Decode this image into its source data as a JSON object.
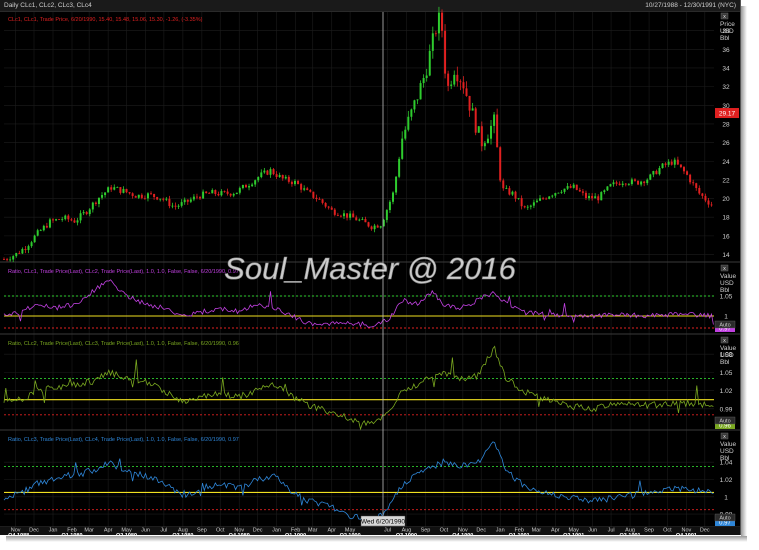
{
  "window": {
    "title": "Daily CLc1, CLc2, CLc3, CLc4",
    "date_range": "10/27/1988 - 12/30/1991 (NYC)"
  },
  "watermark": "Soul_Master @ 2016",
  "crosshair_label": "Wed 6/20/1990",
  "axis_buttons": {
    "close": "x",
    "auto": "Auto"
  },
  "colors": {
    "candle_up": "#2ecc2e",
    "candle_down": "#e02020",
    "ratio1": "#c040e0",
    "ratio2": "#7aa820",
    "ratio3": "#2e86d8",
    "band_upper": "#2ecc2e",
    "band_lower": "#e02020",
    "mean_line": "#f0e020",
    "price_marker": "#e02020"
  },
  "chart_data": [
    {
      "type": "candlestick",
      "legend": "CLc1, CLc1, Trade Price, 6/20/1990, 15.40, 15.48, 15.06, 15.30, -1.26, (-3.35%)",
      "axis_header": [
        "Price",
        "USD",
        "Bbl"
      ],
      "y_ticks": [
        14,
        16,
        18,
        20,
        22,
        24,
        26,
        28,
        30,
        32,
        34,
        36,
        38
      ],
      "ylim": [
        13.2,
        40
      ],
      "last_value_label": "29.17",
      "close_series": [
        {
          "date": "1988-10-27",
          "close": 13.5
        },
        {
          "date": "1988-11-15",
          "close": 14.0
        },
        {
          "date": "1988-12-01",
          "close": 14.8
        },
        {
          "date": "1988-12-20",
          "close": 16.2
        },
        {
          "date": "1989-01-10",
          "close": 17.5
        },
        {
          "date": "1989-02-01",
          "close": 17.9
        },
        {
          "date": "1989-02-20",
          "close": 17.6
        },
        {
          "date": "1989-03-10",
          "close": 18.6
        },
        {
          "date": "1989-04-01",
          "close": 20.2
        },
        {
          "date": "1989-04-20",
          "close": 21.2
        },
        {
          "date": "1989-05-10",
          "close": 20.8
        },
        {
          "date": "1989-06-01",
          "close": 20.3
        },
        {
          "date": "1989-06-20",
          "close": 20.4
        },
        {
          "date": "1989-07-10",
          "close": 20.1
        },
        {
          "date": "1989-08-01",
          "close": 19.1
        },
        {
          "date": "1989-08-20",
          "close": 19.6
        },
        {
          "date": "1989-09-10",
          "close": 20.3
        },
        {
          "date": "1989-10-01",
          "close": 20.6
        },
        {
          "date": "1989-10-20",
          "close": 20.5
        },
        {
          "date": "1989-11-10",
          "close": 20.7
        },
        {
          "date": "1989-12-01",
          "close": 21.6
        },
        {
          "date": "1989-12-20",
          "close": 22.5
        },
        {
          "date": "1990-01-05",
          "close": 23.0
        },
        {
          "date": "1990-01-25",
          "close": 22.1
        },
        {
          "date": "1990-02-15",
          "close": 21.7
        },
        {
          "date": "1990-03-05",
          "close": 20.7
        },
        {
          "date": "1990-03-25",
          "close": 19.9
        },
        {
          "date": "1990-04-15",
          "close": 18.7
        },
        {
          "date": "1990-05-05",
          "close": 18.3
        },
        {
          "date": "1990-05-25",
          "close": 17.8
        },
        {
          "date": "1990-06-20",
          "close": 17.0
        },
        {
          "date": "1990-07-05",
          "close": 17.3
        },
        {
          "date": "1990-07-25",
          "close": 20.7
        },
        {
          "date": "1990-08-08",
          "close": 26.5
        },
        {
          "date": "1990-08-25",
          "close": 29.5
        },
        {
          "date": "1990-09-15",
          "close": 33.5
        },
        {
          "date": "1990-10-01",
          "close": 38.0
        },
        {
          "date": "1990-10-10",
          "close": 39.8
        },
        {
          "date": "1990-10-20",
          "close": 31.5
        },
        {
          "date": "1990-11-01",
          "close": 34.0
        },
        {
          "date": "1990-11-15",
          "close": 32.5
        },
        {
          "date": "1990-12-01",
          "close": 29.0
        },
        {
          "date": "1990-12-15",
          "close": 26.0
        },
        {
          "date": "1991-01-05",
          "close": 28.2
        },
        {
          "date": "1991-01-17",
          "close": 21.0
        },
        {
          "date": "1991-02-05",
          "close": 20.5
        },
        {
          "date": "1991-02-25",
          "close": 18.8
        },
        {
          "date": "1991-03-15",
          "close": 19.6
        },
        {
          "date": "1991-04-05",
          "close": 20.4
        },
        {
          "date": "1991-04-25",
          "close": 21.0
        },
        {
          "date": "1991-05-15",
          "close": 21.2
        },
        {
          "date": "1991-06-05",
          "close": 20.1
        },
        {
          "date": "1991-06-25",
          "close": 20.1
        },
        {
          "date": "1991-07-15",
          "close": 21.4
        },
        {
          "date": "1991-08-05",
          "close": 21.9
        },
        {
          "date": "1991-08-25",
          "close": 21.7
        },
        {
          "date": "1991-09-15",
          "close": 22.2
        },
        {
          "date": "1991-10-05",
          "close": 23.4
        },
        {
          "date": "1991-10-25",
          "close": 24.0
        },
        {
          "date": "1991-11-15",
          "close": 22.6
        },
        {
          "date": "1991-12-05",
          "close": 20.6
        },
        {
          "date": "1991-12-30",
          "close": 19.1
        }
      ]
    },
    {
      "type": "line",
      "legend": "Ratio, CLc1, Trade Price(Last), CLc2, Trade Price(Last), 1.0, 1.0, False, False, 6/20/1990, 0.97",
      "axis_header": [
        "Value",
        "USD",
        "Bbl"
      ],
      "y_ticks": [
        1,
        1.05
      ],
      "ylim": [
        0.955,
        1.13
      ],
      "last_value_label": "0.97",
      "bands": {
        "upper": 1.05,
        "lower": 0.97,
        "mean": 1.0
      },
      "series": [
        {
          "date": "1988-10-27",
          "value": 1.0
        },
        {
          "date": "1988-11-25",
          "value": 1.01
        },
        {
          "date": "1988-12-20",
          "value": 1.03
        },
        {
          "date": "1989-01-20",
          "value": 1.02
        },
        {
          "date": "1989-02-20",
          "value": 1.03
        },
        {
          "date": "1989-03-20",
          "value": 1.06
        },
        {
          "date": "1989-04-15",
          "value": 1.09
        },
        {
          "date": "1989-05-15",
          "value": 1.05
        },
        {
          "date": "1989-06-15",
          "value": 1.03
        },
        {
          "date": "1989-07-15",
          "value": 1.02
        },
        {
          "date": "1989-08-15",
          "value": 1.0
        },
        {
          "date": "1989-09-15",
          "value": 1.01
        },
        {
          "date": "1989-10-15",
          "value": 1.02
        },
        {
          "date": "1989-11-15",
          "value": 1.01
        },
        {
          "date": "1989-12-15",
          "value": 1.03
        },
        {
          "date": "1990-01-10",
          "value": 1.02
        },
        {
          "date": "1990-02-10",
          "value": 1.0
        },
        {
          "date": "1990-03-10",
          "value": 0.98
        },
        {
          "date": "1990-04-10",
          "value": 0.98
        },
        {
          "date": "1990-05-10",
          "value": 0.985
        },
        {
          "date": "1990-06-20",
          "value": 0.975
        },
        {
          "date": "1990-07-15",
          "value": 0.99
        },
        {
          "date": "1990-08-10",
          "value": 1.04
        },
        {
          "date": "1990-09-01",
          "value": 1.03
        },
        {
          "date": "1990-09-25",
          "value": 1.06
        },
        {
          "date": "1990-10-15",
          "value": 1.03
        },
        {
          "date": "1990-11-10",
          "value": 1.02
        },
        {
          "date": "1990-12-10",
          "value": 1.04
        },
        {
          "date": "1991-01-05",
          "value": 1.06
        },
        {
          "date": "1991-01-25",
          "value": 1.03
        },
        {
          "date": "1991-02-20",
          "value": 1.01
        },
        {
          "date": "1991-03-20",
          "value": 1.005
        },
        {
          "date": "1991-05-01",
          "value": 1.0
        },
        {
          "date": "1991-06-15",
          "value": 1.0
        },
        {
          "date": "1991-08-01",
          "value": 1.005
        },
        {
          "date": "1991-09-15",
          "value": 1.0
        },
        {
          "date": "1991-11-01",
          "value": 1.005
        },
        {
          "date": "1991-12-30",
          "value": 1.0
        }
      ]
    },
    {
      "type": "line",
      "legend": "Ratio, CLc2, Trade Price(Last), CLc3, Trade Price(Last), 1.0, 1.0, False, False, 6/20/1990, 0.96",
      "axis_header": [
        "Value",
        "USD",
        "Bbl"
      ],
      "y_ticks": [
        0.99,
        1.02,
        1.05,
        1.08
      ],
      "ylim": [
        0.955,
        1.11
      ],
      "last_value_label": "0.96",
      "bands": {
        "upper": 1.04,
        "lower": 0.98,
        "mean": 1.005
      },
      "series": [
        {
          "date": "1988-10-27",
          "value": 1.0
        },
        {
          "date": "1988-11-25",
          "value": 1.005
        },
        {
          "date": "1988-12-20",
          "value": 1.02
        },
        {
          "date": "1989-01-20",
          "value": 1.025
        },
        {
          "date": "1989-02-20",
          "value": 1.03
        },
        {
          "date": "1989-03-20",
          "value": 1.035
        },
        {
          "date": "1989-04-15",
          "value": 1.05
        },
        {
          "date": "1989-05-15",
          "value": 1.04
        },
        {
          "date": "1989-06-15",
          "value": 1.035
        },
        {
          "date": "1989-07-15",
          "value": 1.02
        },
        {
          "date": "1989-08-15",
          "value": 1.0
        },
        {
          "date": "1989-09-15",
          "value": 1.01
        },
        {
          "date": "1989-10-15",
          "value": 1.015
        },
        {
          "date": "1989-11-15",
          "value": 1.01
        },
        {
          "date": "1989-12-15",
          "value": 1.02
        },
        {
          "date": "1990-01-10",
          "value": 1.03
        },
        {
          "date": "1990-02-10",
          "value": 1.01
        },
        {
          "date": "1990-03-10",
          "value": 0.995
        },
        {
          "date": "1990-04-10",
          "value": 0.985
        },
        {
          "date": "1990-05-10",
          "value": 0.975
        },
        {
          "date": "1990-06-20",
          "value": 0.965
        },
        {
          "date": "1990-07-15",
          "value": 0.985
        },
        {
          "date": "1990-08-10",
          "value": 1.02
        },
        {
          "date": "1990-09-01",
          "value": 1.03
        },
        {
          "date": "1990-09-25",
          "value": 1.045
        },
        {
          "date": "1990-10-15",
          "value": 1.05
        },
        {
          "date": "1990-11-10",
          "value": 1.04
        },
        {
          "date": "1990-12-10",
          "value": 1.045
        },
        {
          "date": "1991-01-05",
          "value": 1.09
        },
        {
          "date": "1991-01-25",
          "value": 1.04
        },
        {
          "date": "1991-02-20",
          "value": 1.02
        },
        {
          "date": "1991-03-20",
          "value": 1.01
        },
        {
          "date": "1991-05-01",
          "value": 0.995
        },
        {
          "date": "1991-06-15",
          "value": 0.99
        },
        {
          "date": "1991-08-01",
          "value": 1.0
        },
        {
          "date": "1991-09-15",
          "value": 0.995
        },
        {
          "date": "1991-11-01",
          "value": 1.0
        },
        {
          "date": "1991-12-30",
          "value": 0.995
        }
      ]
    },
    {
      "type": "line",
      "legend": "Ratio, CLc3, Trade Price(Last), CLc4, Trade Price(Last), 1.0, 1.0, False, False, 6/20/1990, 0.97",
      "axis_header": [
        "Value",
        "USD",
        "Bbl"
      ],
      "y_ticks": [
        0.98,
        1,
        1.02,
        1.04
      ],
      "ylim": [
        0.965,
        1.075
      ],
      "last_value_label": "0.97",
      "bands": {
        "upper": 1.035,
        "lower": 0.985,
        "mean": 1.005
      },
      "series": [
        {
          "date": "1988-10-27",
          "value": 1.0
        },
        {
          "date": "1988-11-25",
          "value": 1.005
        },
        {
          "date": "1988-12-20",
          "value": 1.015
        },
        {
          "date": "1989-01-20",
          "value": 1.02
        },
        {
          "date": "1989-02-20",
          "value": 1.025
        },
        {
          "date": "1989-03-20",
          "value": 1.03
        },
        {
          "date": "1989-04-15",
          "value": 1.04
        },
        {
          "date": "1989-05-15",
          "value": 1.03
        },
        {
          "date": "1989-06-15",
          "value": 1.025
        },
        {
          "date": "1989-07-15",
          "value": 1.015
        },
        {
          "date": "1989-08-15",
          "value": 1.0
        },
        {
          "date": "1989-09-15",
          "value": 1.005
        },
        {
          "date": "1989-10-15",
          "value": 1.015
        },
        {
          "date": "1989-11-15",
          "value": 1.01
        },
        {
          "date": "1989-12-15",
          "value": 1.02
        },
        {
          "date": "1990-01-10",
          "value": 1.025
        },
        {
          "date": "1990-02-10",
          "value": 1.005
        },
        {
          "date": "1990-03-10",
          "value": 0.995
        },
        {
          "date": "1990-04-10",
          "value": 0.99
        },
        {
          "date": "1990-05-10",
          "value": 0.98
        },
        {
          "date": "1990-06-20",
          "value": 0.97
        },
        {
          "date": "1990-07-15",
          "value": 0.985
        },
        {
          "date": "1990-08-10",
          "value": 1.015
        },
        {
          "date": "1990-09-01",
          "value": 1.025
        },
        {
          "date": "1990-09-25",
          "value": 1.035
        },
        {
          "date": "1990-10-15",
          "value": 1.04
        },
        {
          "date": "1990-11-10",
          "value": 1.035
        },
        {
          "date": "1990-12-10",
          "value": 1.04
        },
        {
          "date": "1991-01-05",
          "value": 1.065
        },
        {
          "date": "1991-01-25",
          "value": 1.03
        },
        {
          "date": "1991-02-20",
          "value": 1.015
        },
        {
          "date": "1991-03-20",
          "value": 1.005
        },
        {
          "date": "1991-05-01",
          "value": 1.0
        },
        {
          "date": "1991-06-15",
          "value": 0.995
        },
        {
          "date": "1991-08-01",
          "value": 1.0
        },
        {
          "date": "1991-09-15",
          "value": 1.005
        },
        {
          "date": "1991-11-01",
          "value": 1.01
        },
        {
          "date": "1991-12-30",
          "value": 1.005
        }
      ]
    }
  ],
  "x_axis": {
    "months": [
      {
        "label": "Nov",
        "date": "1988-11-15"
      },
      {
        "label": "Dec",
        "date": "1988-12-15"
      },
      {
        "label": "Jan",
        "date": "1989-01-15"
      },
      {
        "label": "Feb",
        "date": "1989-02-15"
      },
      {
        "label": "Mar",
        "date": "1989-03-15"
      },
      {
        "label": "Apr",
        "date": "1989-04-15"
      },
      {
        "label": "May",
        "date": "1989-05-15"
      },
      {
        "label": "Jun",
        "date": "1989-06-15"
      },
      {
        "label": "Jul",
        "date": "1989-07-15"
      },
      {
        "label": "Aug",
        "date": "1989-08-15"
      },
      {
        "label": "Sep",
        "date": "1989-09-15"
      },
      {
        "label": "Oct",
        "date": "1989-10-15"
      },
      {
        "label": "Nov",
        "date": "1989-11-15"
      },
      {
        "label": "Dec",
        "date": "1989-12-15"
      },
      {
        "label": "Jan",
        "date": "1990-01-15"
      },
      {
        "label": "Feb",
        "date": "1990-02-15"
      },
      {
        "label": "Mar",
        "date": "1990-03-15"
      },
      {
        "label": "Apr",
        "date": "1990-04-15"
      },
      {
        "label": "May",
        "date": "1990-05-15"
      },
      {
        "label": "Jul",
        "date": "1990-07-15"
      },
      {
        "label": "Aug",
        "date": "1990-08-15"
      },
      {
        "label": "Sep",
        "date": "1990-09-15"
      },
      {
        "label": "Oct",
        "date": "1990-10-15"
      },
      {
        "label": "Nov",
        "date": "1990-11-15"
      },
      {
        "label": "Dec",
        "date": "1990-12-15"
      },
      {
        "label": "Jan",
        "date": "1991-01-15"
      },
      {
        "label": "Feb",
        "date": "1991-02-15"
      },
      {
        "label": "Mar",
        "date": "1991-03-15"
      },
      {
        "label": "Apr",
        "date": "1991-04-15"
      },
      {
        "label": "May",
        "date": "1991-05-15"
      },
      {
        "label": "Jun",
        "date": "1991-06-15"
      },
      {
        "label": "Jul",
        "date": "1991-07-15"
      },
      {
        "label": "Aug",
        "date": "1991-08-15"
      },
      {
        "label": "Sep",
        "date": "1991-09-15"
      },
      {
        "label": "Oct",
        "date": "1991-10-15"
      },
      {
        "label": "Nov",
        "date": "1991-11-15"
      },
      {
        "label": "Dec",
        "date": "1991-12-15"
      }
    ],
    "quarters": [
      {
        "label": "Q4 1988",
        "date": "1988-11-20"
      },
      {
        "label": "Q1 1989",
        "date": "1989-02-15"
      },
      {
        "label": "Q2 1989",
        "date": "1989-05-15"
      },
      {
        "label": "Q3 1989",
        "date": "1989-08-15"
      },
      {
        "label": "Q4 1989",
        "date": "1989-11-15"
      },
      {
        "label": "Q1 1990",
        "date": "1990-02-15"
      },
      {
        "label": "Q2 1990",
        "date": "1990-05-15"
      },
      {
        "label": "Q3 1990",
        "date": "1990-08-15"
      },
      {
        "label": "Q4 1990",
        "date": "1990-11-15"
      },
      {
        "label": "Q1 1991",
        "date": "1991-02-15"
      },
      {
        "label": "Q2 1991",
        "date": "1991-05-15"
      },
      {
        "label": "Q3 1991",
        "date": "1991-08-15"
      },
      {
        "label": "Q4 1991",
        "date": "1991-11-15"
      }
    ]
  }
}
